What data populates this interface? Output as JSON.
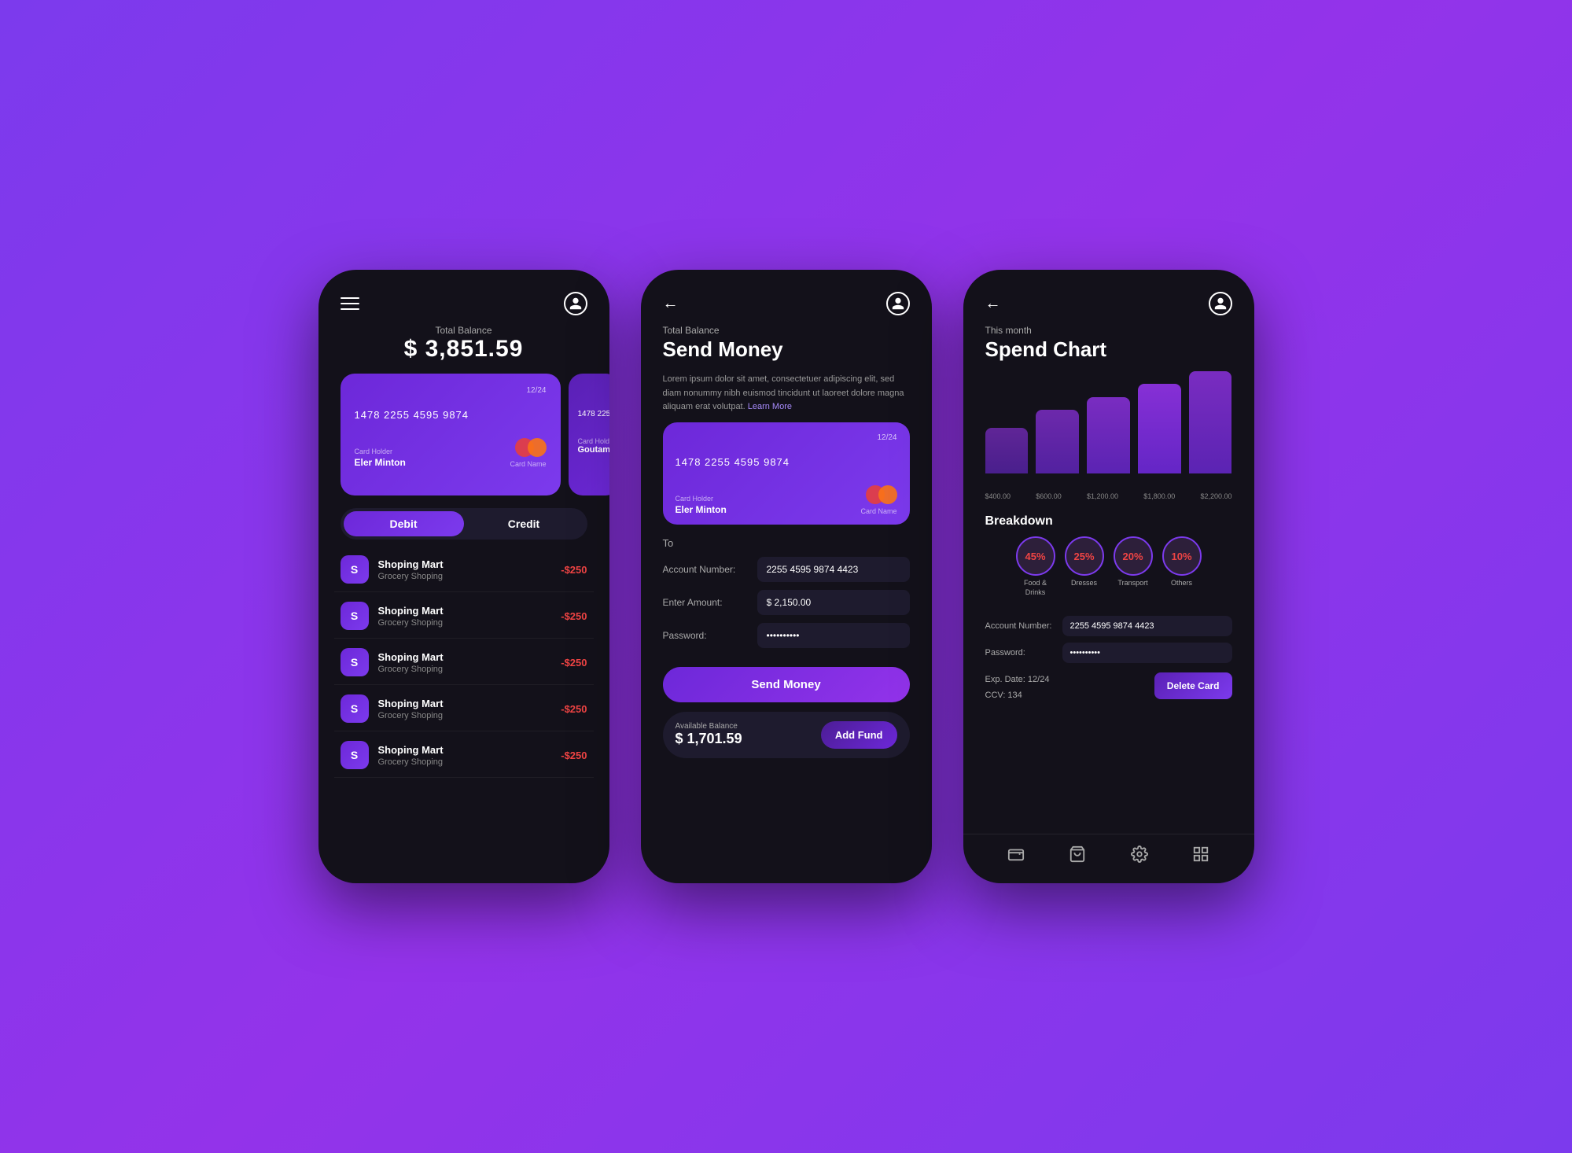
{
  "background": "#8b5cf6",
  "phone1": {
    "header": {
      "menu_icon": "hamburger",
      "user_icon": "user-circle"
    },
    "balance": {
      "label": "Total Balance",
      "amount": "$ 3,851.59"
    },
    "card": {
      "expiry": "12/24",
      "number": "1478 2255 4595 9874",
      "holder_label": "Card Holder",
      "holder_name": "Eler Minton",
      "card_name_label": "Card Name",
      "card_name": ""
    },
    "card2": {
      "number_short": "1478 225",
      "holder_label": "Card Hold",
      "holder_name": "Goutam"
    },
    "tabs": {
      "debit": "Debit",
      "credit": "Credit",
      "active": "debit"
    },
    "transactions": [
      {
        "initial": "S",
        "name": "Shoping Mart",
        "sub": "Grocery Shoping",
        "amount": "-$250"
      },
      {
        "initial": "S",
        "name": "Shoping Mart",
        "sub": "Grocery Shoping",
        "amount": "-$250"
      },
      {
        "initial": "S",
        "name": "Shoping Mart",
        "sub": "Grocery Shoping",
        "amount": "-$250"
      },
      {
        "initial": "S",
        "name": "Shoping Mart",
        "sub": "Grocery Shoping",
        "amount": "-$250"
      },
      {
        "initial": "S",
        "name": "Shoping Mart",
        "sub": "Grocery Shoping",
        "amount": "-$250"
      }
    ]
  },
  "phone2": {
    "header": {
      "back_icon": "←",
      "user_icon": "user-circle"
    },
    "balance": {
      "label": "Total Balance",
      "title": "Send Money"
    },
    "description": "Lorem ipsum dolor sit amet, consectetuer adipiscing elit, sed diam nonummy nibh euismod tincidunt ut laoreet dolore magna aliquam erat volutpat.",
    "learn_more": "Learn More",
    "card": {
      "expiry": "12/24",
      "number": "1478 2255 4595 9874",
      "holder_label": "Card Holder",
      "holder_name": "Eler Minton",
      "card_name": "Card Name"
    },
    "form": {
      "to_label": "To",
      "account_label": "Account Number:",
      "account_value": "2255 4595 9874 4423",
      "amount_label": "Enter Amount:",
      "amount_value": "$ 2,150.00",
      "password_label": "Password:",
      "password_value": "••••••••••"
    },
    "send_button": "Send Money",
    "footer": {
      "avail_label": "Available Balance",
      "avail_amount": "$ 1,701.59",
      "add_fund": "Add Fund"
    }
  },
  "phone3": {
    "header": {
      "back_icon": "←",
      "user_icon": "user-circle"
    },
    "month_label": "This month",
    "chart_title": "Spend Chart",
    "chart": {
      "bars": [
        45,
        62,
        75,
        85,
        100
      ],
      "labels": [
        "$400.00",
        "$600.00",
        "$1,200.00",
        "$1,800.00",
        "$2,200.00"
      ]
    },
    "breakdown": {
      "title": "Breakdown",
      "items": [
        {
          "percent": "45%",
          "label": "Food &\nDrinks"
        },
        {
          "percent": "25%",
          "label": "Dresses"
        },
        {
          "percent": "20%",
          "label": "Transport"
        },
        {
          "percent": "10%",
          "label": "Others"
        }
      ]
    },
    "account": {
      "number_label": "Account Number:",
      "number_value": "2255 4595 9874 4423",
      "password_label": "Password:",
      "password_value": "••••••••••"
    },
    "exp_date": "Exp. Date: 12/24",
    "ccv": "CCV: 134",
    "delete_card": "Delete Card",
    "nav": {
      "icons": [
        "wallet",
        "cart",
        "settings",
        "grid"
      ]
    }
  }
}
